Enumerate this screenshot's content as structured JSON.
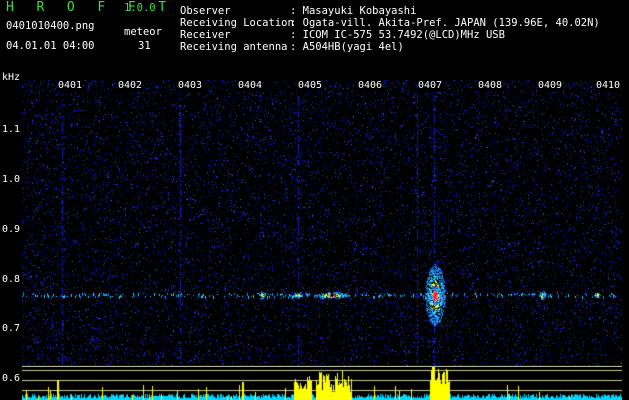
{
  "header": {
    "brand": "H R O F F T",
    "version": "1.0.0",
    "filename": "0401010400.png",
    "datetime": "04.01.01 04:00",
    "meteor_label": "meteor",
    "meteor_count": "31"
  },
  "info": [
    {
      "label": "Observer",
      "value": ": Masayuki Kobayashi"
    },
    {
      "label": "Receiving Location",
      "value": ": Ogata-vill. Akita-Pref. JAPAN (139.96E, 40.02N)"
    },
    {
      "label": "Receiver",
      "value": ": ICOM IC-575 53.7492(@LCD)MHz USB"
    },
    {
      "label": "Receiving antenna",
      "value": ": A504HB(yagi 4el)"
    }
  ],
  "axis": {
    "unit": "kHz",
    "y_ticks": [
      "1.1",
      "1.0",
      "0.9",
      "0.8",
      "0.7",
      "0.6"
    ],
    "x_ticks": [
      "0401",
      "0402",
      "0403",
      "0404",
      "0405",
      "0406",
      "0407",
      "0408",
      "0409",
      "0410"
    ]
  },
  "colors": {
    "background": "#000000",
    "noise": "#1a2cff",
    "echo_line": "#22e0ff",
    "echo_hot": "#ff2080",
    "graph_yellow": "#ffff00",
    "graph_cyan": "#00d8ff",
    "brand_green": "#38e038"
  }
}
